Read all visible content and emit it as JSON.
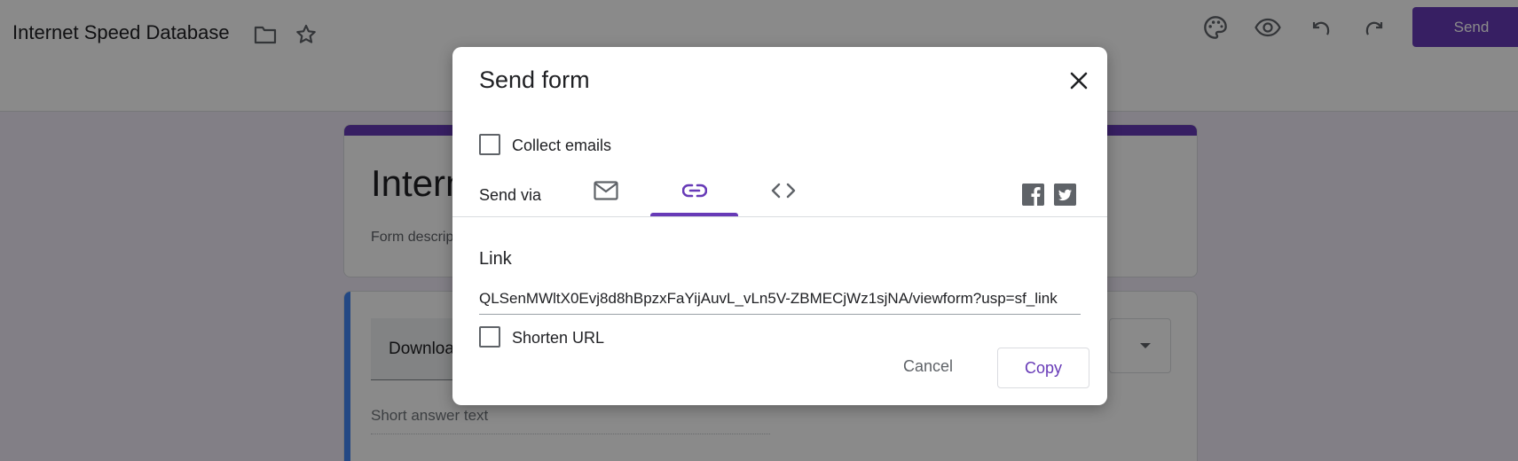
{
  "header": {
    "doc_title": "Internet Speed Database",
    "send_label": "Send"
  },
  "form": {
    "title": "Internet Speed Database",
    "description_placeholder": "Form description",
    "question": {
      "title": "Download speed",
      "answer_hint": "Short answer text"
    }
  },
  "dialog": {
    "title": "Send form",
    "collect_emails_label": "Collect emails",
    "send_via_label": "Send via",
    "link_section_label": "Link",
    "link_url": "QLSenMWltX0Evj8d8hBpzxFaYijAuvL_vLn5V-ZBMECjWz1sjNA/viewform?usp=sf_link",
    "shorten_url_label": "Shorten URL",
    "cancel_label": "Cancel",
    "copy_label": "Copy",
    "accent_color": "#673ab7"
  },
  "icons": {
    "toolbar": [
      "palette-icon",
      "preview-eye-icon",
      "undo-icon",
      "redo-icon"
    ],
    "title": [
      "folder-icon",
      "star-icon"
    ],
    "tabs": [
      "email-icon",
      "link-icon",
      "embed-code-icon"
    ],
    "share": [
      "facebook-icon",
      "twitter-icon"
    ]
  }
}
